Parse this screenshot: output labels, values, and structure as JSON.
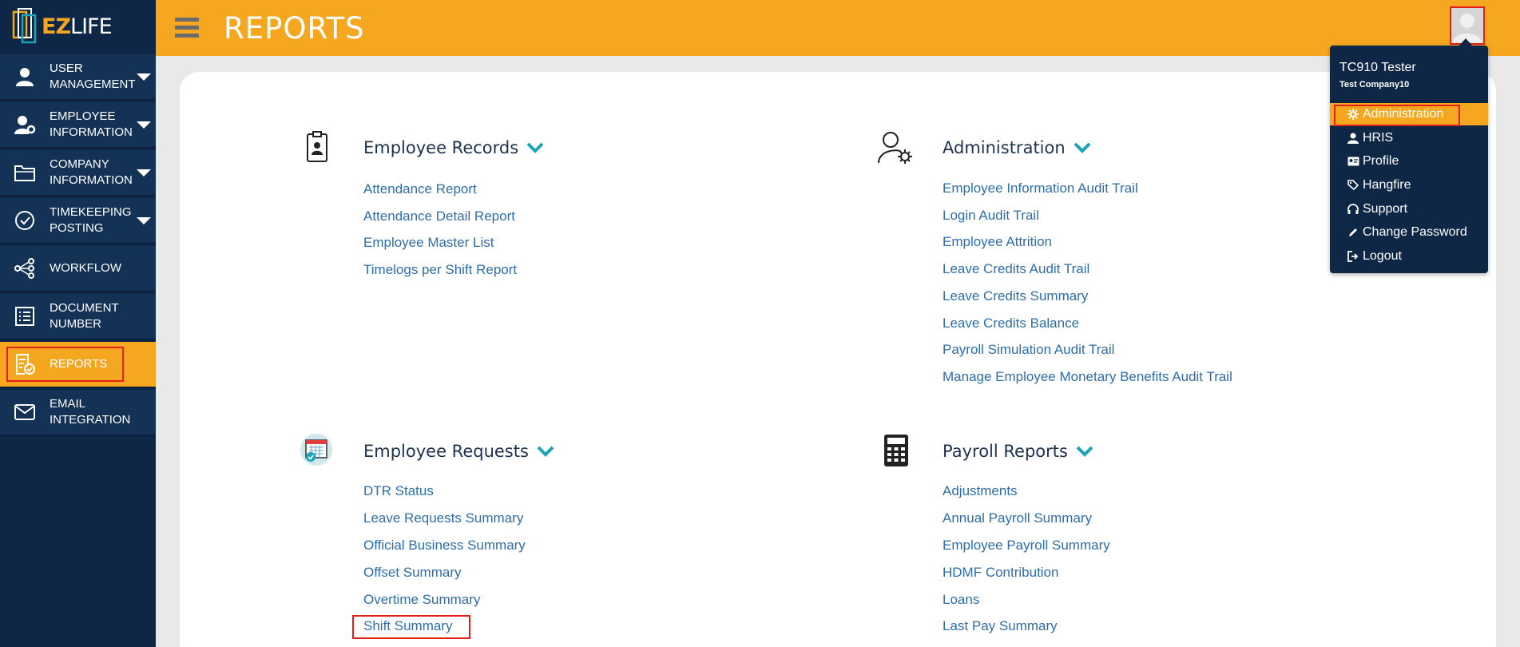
{
  "app": {
    "logo_ez": "EZ",
    "logo_life": "LIFE"
  },
  "header": {
    "title": "REPORTS"
  },
  "sidebar": {
    "items": [
      {
        "label": "USER MANAGEMENT"
      },
      {
        "label": "EMPLOYEE INFORMATION"
      },
      {
        "label": "COMPANY INFORMATION"
      },
      {
        "label": "TIMEKEEPING POSTING"
      },
      {
        "label": "WORKFLOW"
      },
      {
        "label": "DOCUMENT NUMBER"
      },
      {
        "label": "REPORTS"
      },
      {
        "label": "EMAIL INTEGRATION"
      }
    ]
  },
  "sections": {
    "employee_records": {
      "title": "Employee Records",
      "links": [
        "Attendance Report",
        "Attendance Detail Report",
        "Employee Master List",
        "Timelogs per Shift Report"
      ]
    },
    "administration": {
      "title": "Administration",
      "links": [
        "Employee Information Audit Trail",
        "Login Audit Trail",
        "Employee Attrition",
        "Leave Credits Audit Trail",
        "Leave Credits Summary",
        "Leave Credits Balance",
        "Payroll Simulation Audit Trail",
        "Manage Employee Monetary Benefits Audit Trail"
      ]
    },
    "employee_requests": {
      "title": "Employee Requests",
      "links": [
        "DTR Status",
        "Leave Requests Summary",
        "Official Business Summary",
        "Offset Summary",
        "Overtime Summary",
        "Shift Summary"
      ]
    },
    "payroll_reports": {
      "title": "Payroll Reports",
      "links": [
        "Adjustments",
        "Annual Payroll Summary",
        "Employee Payroll Summary",
        "HDMF Contribution",
        "Loans",
        "Last Pay Summary"
      ]
    }
  },
  "user_menu": {
    "name": "TC910 Tester",
    "company": "Test Company10",
    "items": [
      "Administration",
      "HRIS",
      "Profile",
      "Hangfire",
      "Support",
      "Change Password",
      "Logout"
    ]
  },
  "colors": {
    "accent": "#f5a81f",
    "navy": "#0f2747",
    "link": "#2f6ea8",
    "highlight_border": "#e5201b",
    "chevron": "#1ba3b8"
  }
}
